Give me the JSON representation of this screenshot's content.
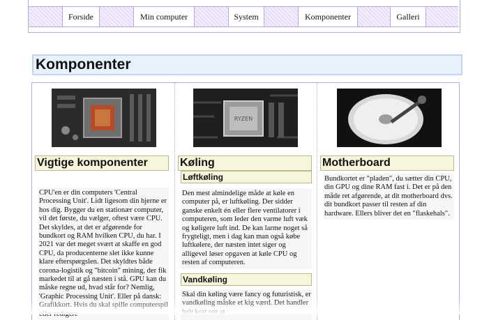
{
  "nav": {
    "items": [
      {
        "label": "Forside"
      },
      {
        "label": "Min computer"
      },
      {
        "label": "System"
      },
      {
        "label": "Komponenter"
      },
      {
        "label": "Galleri"
      }
    ]
  },
  "page": {
    "title": "Komponenter"
  },
  "columns": [
    {
      "image_alt": "CPU socket on motherboard",
      "heading": "Vigtige komponenter",
      "paragraph": "CPU'en er din computers 'Central Processing Unit'. Lidt ligesom din hjerne er hos dig. Bygger du en stationær computer, vil det første, du vælger, oftest være CPU. Det skyldes, at det er afgørende for bundkort og RAM hvilken CPU, du har. I 2021 var det meget svært at skaffe en god CPU, da producenterne slet ikke kunne klare efterspørgslen. Det skyldtes både corona-logistik og \"bitcoin\" mining, der fik markedet til at gå næsten i stå. GPU kan du måske regne ud, hvad står for? Nemlig, 'Graphic Processing Unit'. Eller på dansk: Grafikkort. Hvis du skal spille computerspil eller redigere"
    },
    {
      "image_alt": "CPU mounted in motherboard",
      "heading": "Køling",
      "sub1": "Løftkøling",
      "para1": "Den mest almindelige måde at køle en computer på, er luftkøling. Der sidder ganske enkelt én eller flere ventilatorer i computeren, som leder den varme luft væk og køligere luft ind. De kan larme noget så frygteligt, men i dag kan man også købe luftkølere, der næsten intet siger og alligevel løser opgaven at køle CPU og resten af computeren.",
      "sub2": "Vandkøling",
      "para2": "Skal din køling være fancy og futuristisk, er vandkøling måske et kig værd. Det handler helt kort om at"
    },
    {
      "image_alt": "Open hard drive platter",
      "heading": "Motherboard",
      "paragraph": "Bundkortet er \"pladen\", du sætter din CPU, din GPU og dine RAM fast i. Det er på den måde ret afgørende, at dit motherboard dvs. dit bundkort passer til resten af din hardware. Ellers bliver det en \"flaskehals\"."
    }
  ]
}
